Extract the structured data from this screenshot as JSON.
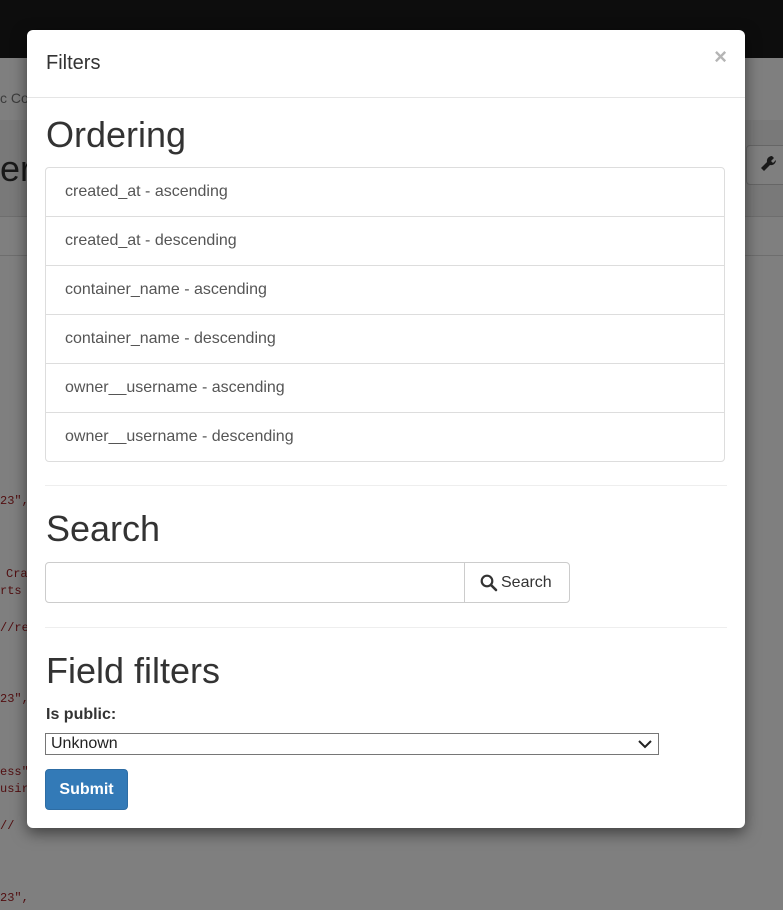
{
  "background": {
    "breadcrumb_fragment": "c Co",
    "heading_fragment": "er",
    "code_lines": [
      "23\",",
      "Cra",
      "rts",
      "//re",
      "23\",",
      "ess\"",
      "usir",
      "//",
      "23\","
    ]
  },
  "modal": {
    "title": "Filters",
    "close_label": "×",
    "ordering": {
      "title": "Ordering",
      "items": [
        "created_at - ascending",
        "created_at - descending",
        "container_name - ascending",
        "container_name - descending",
        "owner__username - ascending",
        "owner__username - descending"
      ]
    },
    "search": {
      "title": "Search",
      "input_value": "",
      "button_label": "Search"
    },
    "field_filters": {
      "title": "Field filters",
      "is_public_label": "Is public:",
      "is_public_selected": "Unknown"
    },
    "submit_label": "Submit"
  },
  "colors": {
    "primary": "#337ab7",
    "overlay": "rgba(0,0,0,0.5)",
    "topbar": "#1b1b1b"
  }
}
